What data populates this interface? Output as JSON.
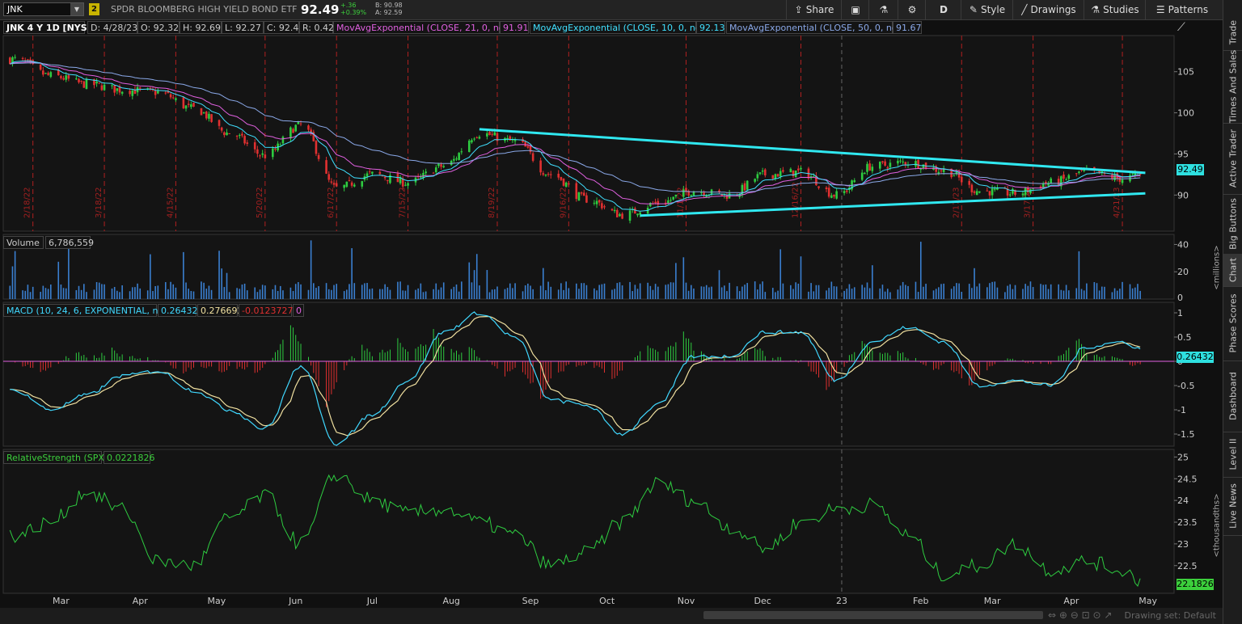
{
  "header": {
    "symbol": "JNK",
    "link_badge": "2",
    "description": "SPDR BLOOMBERG HIGH YIELD BOND ETF",
    "last": "92.49",
    "change": "+.36",
    "change_pct": "+0.39%",
    "bid": "B: 90.98",
    "ask": "A: 92.59",
    "toolbar": {
      "share": "Share",
      "timeframe": "D",
      "style": "Style",
      "drawings": "Drawings",
      "studies": "Studies",
      "patterns": "Patterns"
    }
  },
  "infobar": {
    "title": "JNK 4 Y 1D [NYSE]",
    "date": "D: 4/28/23",
    "open": "O: 92.32",
    "high": "H: 92.69",
    "low": "L: 92.27",
    "close": "C: 92.49",
    "range": "R: 0.42",
    "ema21_label": "MovAvgExponential (CLOSE, 21, 0, no)",
    "ema21_value": "91.91",
    "ema10_label": "MovAvgExponential (CLOSE, 10, 0, no)",
    "ema10_value": "92.13",
    "ema50_label": "MovAvgExponential (CLOSE, 50, 0, no)",
    "ema50_value": "91.67"
  },
  "panels": {
    "volume_label": "Volume",
    "volume_value": "6,786,559",
    "volume_unit": "<millions>",
    "macd_label": "MACD (10, 24, 6, EXPONENTIAL, no)",
    "macd_value": "0.26432",
    "macd_avg": "0.276692",
    "macd_diff": "-0.0123727",
    "macd_zero": "0",
    "rs_label": "RelativeStrength (SPX)",
    "rs_value": "0.0221826",
    "rs_unit": "<thousandths>",
    "price_tag": "92.49",
    "macd_tag": "0.26432",
    "rs_tag": "22.1826"
  },
  "sidebar": {
    "tabs": [
      "Trade",
      "Times And Sales",
      "Active Trader",
      "Big Buttons",
      "Chart",
      "Phase Scores",
      "Dashboard",
      "Level II",
      "Live News"
    ]
  },
  "footer": {
    "drawing_set": "Drawing set: Default"
  },
  "chart_data": [
    {
      "type": "candlestick",
      "title": "JNK 4 Y 1D [NYSE]",
      "x_tick_labels": [
        "Mar",
        "Apr",
        "May",
        "Jun",
        "Jul",
        "Aug",
        "Sep",
        "Oct",
        "Nov",
        "Dec",
        "23",
        "Feb",
        "Mar",
        "Apr",
        "May"
      ],
      "ylim": [
        86,
        109
      ],
      "y_ticks": [
        90,
        95,
        100,
        105
      ],
      "closing_price_path": {
        "x": [
          "2022-02-11",
          "2022-02-25",
          "2022-03-11",
          "2022-03-25",
          "2022-04-08",
          "2022-04-22",
          "2022-05-06",
          "2022-05-20",
          "2022-06-03",
          "2022-06-17",
          "2022-07-01",
          "2022-07-15",
          "2022-07-29",
          "2022-08-12",
          "2022-08-26",
          "2022-09-09",
          "2022-09-23",
          "2022-10-07",
          "2022-10-21",
          "2022-11-04",
          "2022-11-18",
          "2022-12-02",
          "2022-12-16",
          "2022-12-30",
          "2023-01-13",
          "2023-01-27",
          "2023-02-10",
          "2023-02-24",
          "2023-03-10",
          "2023-03-24",
          "2023-04-07",
          "2023-04-21",
          "2023-04-28"
        ],
        "y": [
          106.5,
          104.5,
          103.5,
          102.8,
          102.5,
          100.5,
          97.5,
          94.8,
          98.5,
          90.8,
          92.5,
          91.5,
          93.5,
          97.5,
          96.5,
          92.5,
          89.5,
          87.6,
          89.0,
          90.5,
          90.0,
          92.5,
          92.8,
          90.0,
          93.5,
          94.0,
          93.0,
          90.5,
          90.2,
          91.5,
          92.8,
          92.0,
          92.49
        ]
      },
      "series": [
        {
          "name": "MovAvgExponential (CLOSE, 21, 0, no)",
          "last": 91.91
        },
        {
          "name": "MovAvgExponential (CLOSE, 10, 0, no)",
          "last": 92.13
        },
        {
          "name": "MovAvgExponential (CLOSE, 50, 0, no)",
          "last": 91.67
        }
      ],
      "trendlines": [
        {
          "name": "upper",
          "x": [
            "2022-08-12",
            "2023-04-30"
          ],
          "y": [
            98.0,
            92.7
          ]
        },
        {
          "name": "lower",
          "x": [
            "2022-10-14",
            "2023-04-30"
          ],
          "y": [
            87.5,
            90.2
          ]
        }
      ],
      "date_annotations": [
        "2/18/22",
        "3/18/22",
        "4/15/22",
        "5/20/22",
        "6/17/22",
        "7/15/22",
        "8/19/22",
        "9/16/22",
        "11/1/22",
        "12/16/22",
        "2/17/23",
        "3/17/23",
        "4/21/23"
      ]
    },
    {
      "type": "bar",
      "title": "Volume",
      "unit": "<millions>",
      "ylim": [
        0,
        45
      ],
      "y_ticks": [
        20,
        40
      ],
      "last": 6786559
    },
    {
      "type": "line",
      "title": "MACD (10, 24, 6, EXPONENTIAL, no)",
      "ylim": [
        -1.75,
        1.15
      ],
      "y_ticks": [
        -1.5,
        -1,
        -0.5,
        0,
        0.5,
        1
      ],
      "series": [
        {
          "name": "MACD",
          "last": 0.26432
        },
        {
          "name": "Avg",
          "last": 0.276692
        },
        {
          "name": "Diff",
          "last": -0.0123727
        }
      ],
      "macd_path": {
        "x": [
          "2022-02-11",
          "2022-02-25",
          "2022-03-11",
          "2022-03-25",
          "2022-04-08",
          "2022-04-22",
          "2022-05-06",
          "2022-05-20",
          "2022-06-03",
          "2022-06-17",
          "2022-07-01",
          "2022-07-15",
          "2022-07-29",
          "2022-08-12",
          "2022-08-26",
          "2022-09-09",
          "2022-09-23",
          "2022-10-07",
          "2022-10-21",
          "2022-11-04",
          "2022-11-18",
          "2022-12-02",
          "2022-12-16",
          "2022-12-30",
          "2023-01-13",
          "2023-01-27",
          "2023-02-10",
          "2023-02-24",
          "2023-03-10",
          "2023-03-24",
          "2023-04-07",
          "2023-04-21",
          "2023-04-28"
        ],
        "y": [
          -0.6,
          -1.0,
          -0.7,
          -0.3,
          -0.2,
          -0.6,
          -1.0,
          -1.4,
          -0.1,
          -1.7,
          -1.1,
          -0.4,
          0.6,
          1.0,
          0.5,
          -0.8,
          -0.9,
          -1.5,
          -0.9,
          0.1,
          0.1,
          0.6,
          0.6,
          -0.4,
          0.4,
          0.7,
          0.4,
          -0.5,
          -0.4,
          -0.5,
          0.3,
          0.4,
          0.264
        ]
      }
    },
    {
      "type": "line",
      "title": "RelativeStrength (SPX)",
      "unit": "<thousandths>",
      "ylim": [
        21.9,
        25.1
      ],
      "y_ticks": [
        22.5,
        23,
        23.5,
        24,
        24.5,
        25
      ],
      "path": {
        "x": [
          "2022-02-11",
          "2022-02-25",
          "2022-03-11",
          "2022-03-25",
          "2022-04-08",
          "2022-04-22",
          "2022-05-06",
          "2022-05-20",
          "2022-06-03",
          "2022-06-17",
          "2022-07-01",
          "2022-07-15",
          "2022-07-29",
          "2022-08-12",
          "2022-08-26",
          "2022-09-09",
          "2022-09-23",
          "2022-10-07",
          "2022-10-21",
          "2022-11-04",
          "2022-11-18",
          "2022-12-02",
          "2022-12-16",
          "2022-12-30",
          "2023-01-13",
          "2023-01-27",
          "2023-02-10",
          "2023-02-24",
          "2023-03-10",
          "2023-03-24",
          "2023-04-07",
          "2023-04-21",
          "2023-04-28"
        ],
        "y": [
          23.2,
          23.5,
          24.2,
          23.8,
          22.6,
          22.5,
          23.6,
          24.1,
          23.0,
          24.6,
          24.0,
          23.7,
          23.8,
          23.5,
          23.2,
          22.5,
          22.8,
          23.5,
          24.4,
          24.0,
          23.4,
          22.9,
          23.5,
          23.8,
          23.9,
          23.2,
          22.3,
          22.5,
          23.0,
          22.4,
          22.6,
          22.4,
          22.18
        ]
      }
    }
  ]
}
